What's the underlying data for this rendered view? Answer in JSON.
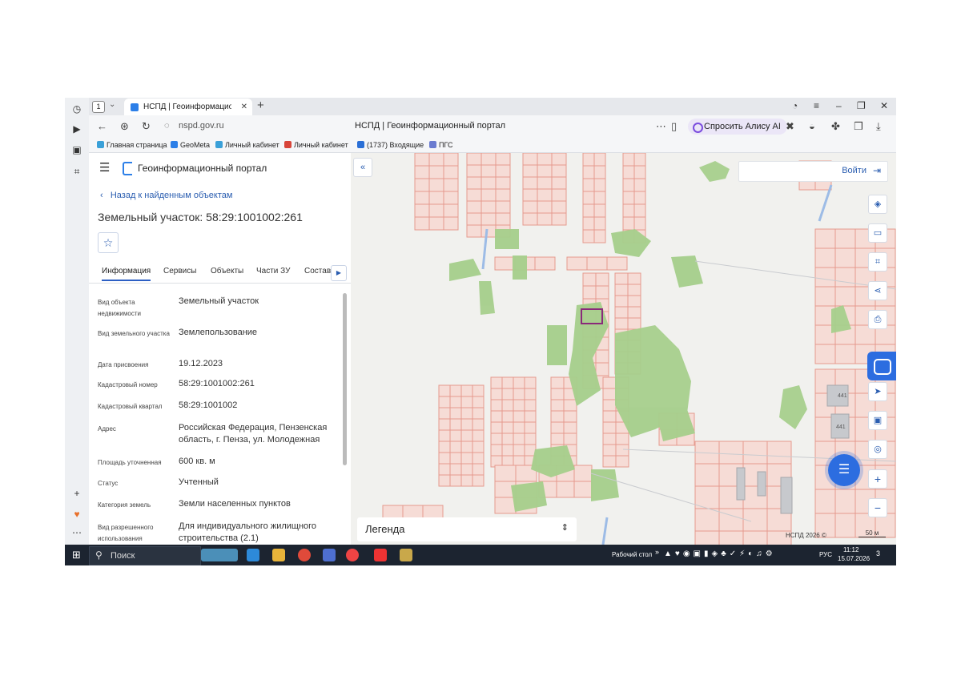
{
  "browser": {
    "tab_count": "1",
    "tab_title": "НСПД | Геоинформационі",
    "url": "nspd.gov.ru",
    "page_title": "НСПД | Геоинформационный портал",
    "alice_label": "Спросить Алису AI",
    "bookmarks": [
      "Главная страница",
      "GeoMeta",
      "Личный кабинет",
      "Личный кабинет",
      "(1737) Входящие",
      "ПГС"
    ]
  },
  "portal": {
    "title": "Геоинформационный портал",
    "back_label": "Назад к найденным объектам",
    "object_title": "Земельный участок: 58:29:1001002:261",
    "tabs": [
      "Информация",
      "Сервисы",
      "Объекты",
      "Части ЗУ",
      "Состав"
    ],
    "fields": [
      {
        "label": "Вид объекта недвижимости",
        "value": "Земельный участок"
      },
      {
        "label": "Вид земельного участка",
        "value": "Землепользование"
      },
      {
        "label": "Дата присвоения",
        "value": "19.12.2023"
      },
      {
        "label": "Кадастровый номер",
        "value": "58:29:1001002:261"
      },
      {
        "label": "Кадастровый квартал",
        "value": "58:29:1001002"
      },
      {
        "label": "Адрес",
        "value": "Российская Федерация, Пензенская область, г. Пенза, ул. Молодежная"
      },
      {
        "label": "Площадь уточненная",
        "value": "600 кв. м"
      },
      {
        "label": "Статус",
        "value": "Учтенный"
      },
      {
        "label": "Категория земель",
        "value": "Земли населенных пунктов"
      },
      {
        "label": "Вид разрешенного использования",
        "value": "Для индивидуального жилищного строительства (2.1)"
      }
    ]
  },
  "map": {
    "login_label": "Войти",
    "legend_label": "Легенда",
    "copyright": "НСПД 2026 ©",
    "scale_label": "50 м",
    "building_labels": [
      "441",
      "441"
    ],
    "colors": {
      "parcel_fill": "#f6dcd6",
      "parcel_stroke": "#e59a8e",
      "vegetation": "#a6cf8c",
      "selected": "#8a2a7a",
      "accent": "#2c6de0"
    }
  },
  "taskbar": {
    "search_label": "Поиск",
    "desktop_label": "Рабочий стол",
    "lang": "РУС",
    "time": "11:12",
    "date": "15.07.2026",
    "notifications": "3"
  }
}
